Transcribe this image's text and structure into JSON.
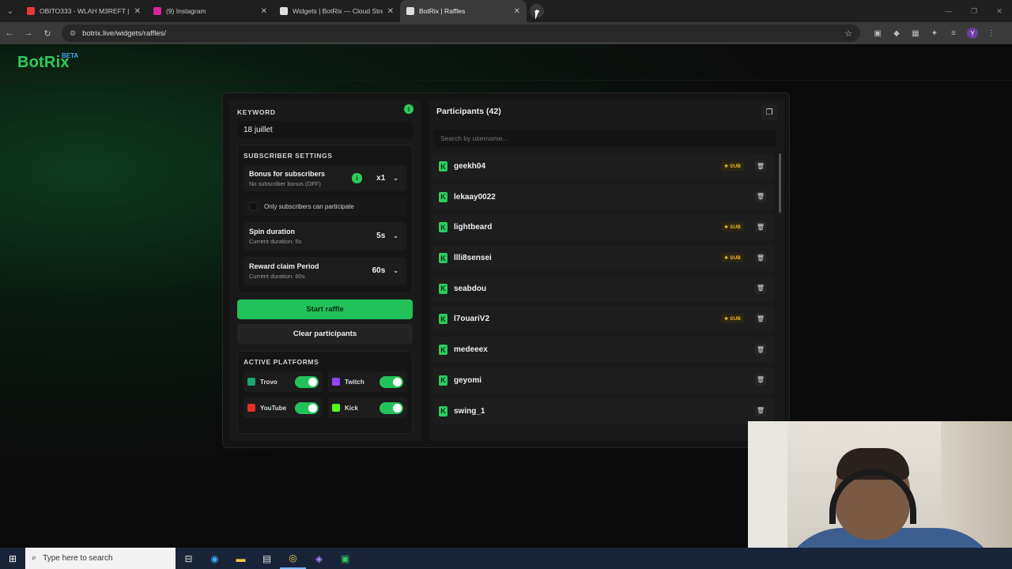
{
  "browser": {
    "tabs": [
      {
        "title": "OBITO333 - WLAH M3REFT | O",
        "favicon_color": "#e53935",
        "active": false
      },
      {
        "title": "(9) Instagram",
        "favicon_color": "#d6249f",
        "active": false
      },
      {
        "title": "Widgets | BotRix — Cloud Strea",
        "favicon_color": "#dddddd",
        "active": false
      },
      {
        "title": "BotRix | Raffles",
        "favicon_color": "#dddddd",
        "active": true
      }
    ],
    "url": "botrix.live/widgets/raffles/"
  },
  "site": {
    "logo": "BotRix",
    "badge": "BETA"
  },
  "settings": {
    "keyword_label": "KEYWORD",
    "keyword_value": "18 juillet",
    "subscriber_title": "SUBSCRIBER SETTINGS",
    "bonus": {
      "title": "Bonus for subscribers",
      "subtitle": "No subscriber bonus (OFF)",
      "value": "x1"
    },
    "only_subs_label": "Only subscribers can participate",
    "spin": {
      "title": "Spin duration",
      "subtitle": "Current duration: 5s",
      "value": "5s"
    },
    "claim": {
      "title": "Reward claim Period",
      "subtitle": "Current duration: 60s",
      "value": "60s"
    },
    "start_label": "Start raffle",
    "clear_label": "Clear participants",
    "platforms_title": "ACTIVE PLATFORMS",
    "platforms": [
      {
        "name": "Trovo",
        "enabled": true,
        "color": "#1ea672"
      },
      {
        "name": "Twitch",
        "enabled": true,
        "color": "#9146ff"
      },
      {
        "name": "YouTube",
        "enabled": true,
        "color": "#e52d27"
      },
      {
        "name": "Kick",
        "enabled": true,
        "color": "#53fc18"
      }
    ]
  },
  "participants": {
    "title": "Participants (42)",
    "search_placeholder": "Search by username...",
    "sub_label": "SUB",
    "items": [
      {
        "name": "geekh04",
        "sub": true
      },
      {
        "name": "lekaay0022",
        "sub": false
      },
      {
        "name": "lightbeard",
        "sub": true
      },
      {
        "name": "llli8sensei",
        "sub": true
      },
      {
        "name": "seabdou",
        "sub": false
      },
      {
        "name": "l7ouariV2",
        "sub": true
      },
      {
        "name": "medeeex",
        "sub": false
      },
      {
        "name": "geyomi",
        "sub": false
      },
      {
        "name": "swing_1",
        "sub": false
      }
    ]
  },
  "taskbar": {
    "search_placeholder": "Type here to search"
  }
}
